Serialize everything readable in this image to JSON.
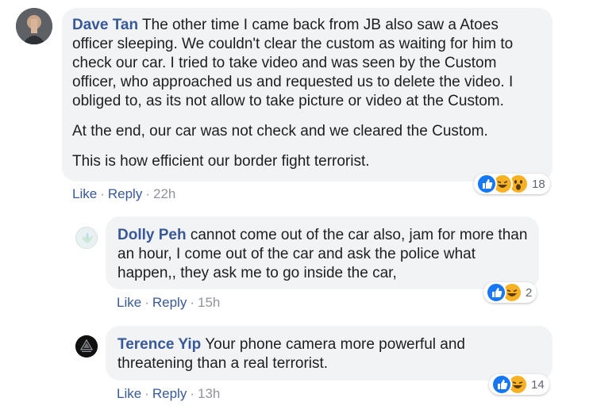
{
  "comments": [
    {
      "author": "Dave Tan",
      "paragraphs": [
        "The other time I came back from JB also saw a Atoes officer sleeping. We couldn't clear the custom as waiting for him to check our car. I tried to take video and was seen by the Custom officer, who approached us and requested us to delete the video. I obliged to, as its not allow to take picture or video at the Custom.",
        "At the end, our car was not check and we cleared the Custom.",
        "This is how efficient our border fight terrorist."
      ],
      "like": "Like",
      "reply": "Reply",
      "time": "22h",
      "reaction_icons": [
        "like-reaction-icon",
        "haha-reaction-icon",
        "wow-reaction-icon"
      ],
      "reaction_count": "18"
    },
    {
      "author": "Dolly Peh",
      "paragraphs": [
        "cannot come out of the car also, jam for more than an hour, I come out of the car and ask the police what happen,, they ask me to go inside the car,"
      ],
      "like": "Like",
      "reply": "Reply",
      "time": "15h",
      "reaction_icons": [
        "like-reaction-icon",
        "haha-reaction-icon"
      ],
      "reaction_count": "2"
    },
    {
      "author": "Terence Yip",
      "paragraphs": [
        "Your phone camera more powerful and threatening than a real terrorist."
      ],
      "like": "Like",
      "reply": "Reply",
      "time": "13h",
      "reaction_icons": [
        "like-reaction-icon",
        "haha-reaction-icon"
      ],
      "reaction_count": "14"
    }
  ],
  "separator": "·",
  "colors": {
    "link": "#385898",
    "bubble": "#f2f3f5",
    "muted": "#90949c",
    "like_blue": "#1877f2",
    "haha_yellow": "#f7b125"
  }
}
